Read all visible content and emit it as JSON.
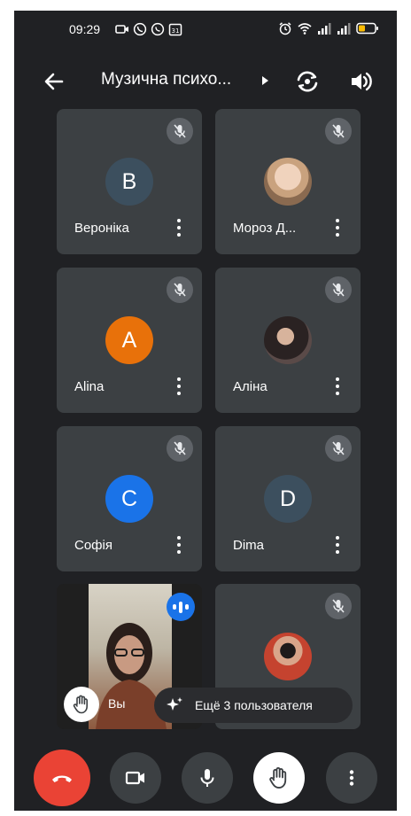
{
  "status_bar": {
    "time": "09:29",
    "left_icons": [
      "screen-record-icon",
      "viber-icon",
      "whatsapp-icon",
      "calendar-31-icon"
    ],
    "right_icons": [
      "alarm-icon",
      "wifi-icon",
      "signal-icon",
      "signal-icon",
      "battery-icon"
    ]
  },
  "top_bar": {
    "meeting_title": "Музична психо...",
    "icons": [
      "back-arrow-icon",
      "caret-right-icon",
      "switch-camera-icon",
      "speaker-icon"
    ]
  },
  "participants": [
    {
      "name": "Вероніка",
      "initial": "В",
      "avatar_color": "#3c4f5e",
      "muted": true
    },
    {
      "name": "Мороз Д...",
      "initial": "",
      "avatar_color": "#c9b29b",
      "muted": true
    },
    {
      "name": "Alina",
      "initial": "A",
      "avatar_color": "#e8710a",
      "muted": true
    },
    {
      "name": "Аліна",
      "initial": "",
      "avatar_color": "#3a3232",
      "muted": true
    },
    {
      "name": "Софія",
      "initial": "C",
      "avatar_color": "#1a73e8",
      "muted": true
    },
    {
      "name": "Dima",
      "initial": "D",
      "avatar_color": "#3c4f5e",
      "muted": true
    },
    {
      "name": "",
      "initial": "",
      "avatar_color": "#c5432f",
      "muted": true
    }
  ],
  "self_tile": {
    "label": "Вы",
    "speaking": true,
    "hand_raised": true
  },
  "more_users": {
    "label": "Ещё 3 пользователя"
  },
  "controls": {
    "end_call_color": "#ea4335",
    "buttons": [
      "end-call",
      "camera",
      "microphone",
      "raise-hand",
      "more-options"
    ]
  },
  "colors": {
    "background": "#202124",
    "tile": "#3c4043",
    "accent_blue": "#1a73e8"
  }
}
